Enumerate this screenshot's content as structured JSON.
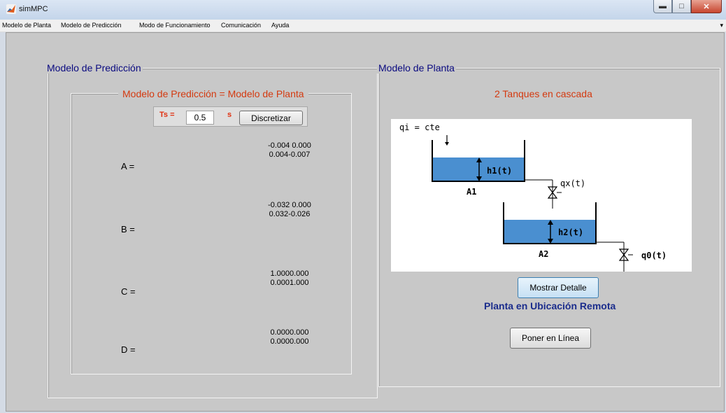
{
  "window": {
    "title": "simMPC"
  },
  "menu": [
    "Modelo de Planta",
    "Modelo de Predicción",
    "Modo de Funcionamiento",
    "Comunicación",
    "Ayuda"
  ],
  "left_panel": {
    "title": "Modelo de Predicción",
    "subtitle": "Modelo de Predicción = Modelo de Planta",
    "ts_label": "Ts =",
    "ts_value": "0.5",
    "ts_unit": "s",
    "discretize_label": "Discretizar",
    "matrices": [
      {
        "label": "A =",
        "row1": "-0.004 0.000",
        "row2": "0.004-0.007"
      },
      {
        "label": "B =",
        "row1": "-0.032 0.000",
        "row2": "0.032-0.026"
      },
      {
        "label": "C =",
        "row1": "1.0000.000",
        "row2": "0.0001.000"
      },
      {
        "label": "D =",
        "row1": "0.0000.000",
        "row2": "0.0000.000"
      }
    ]
  },
  "right_panel": {
    "title": "Modelo de Planta",
    "plant_name": "2 Tanques en cascada",
    "diagram": {
      "qi": "qi = cte",
      "h1": "h1(t)",
      "a1": "A1",
      "qx": "qx(t)",
      "h2": "h2(t)",
      "a2": "A2",
      "q0": "q0(t)",
      "water_color": "#4a8fd0"
    },
    "show_detail_label": "Mostrar Detalle",
    "remote_status": "Planta en Ubicación Remota",
    "online_label": "Poner en Línea"
  },
  "colors": {
    "title_blue": "#0a0a80",
    "accent_red": "#d43a10",
    "status_blue": "#1a2c8c"
  }
}
